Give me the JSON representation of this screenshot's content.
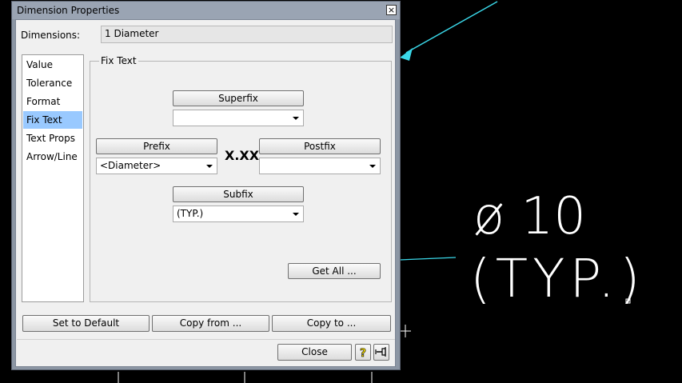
{
  "window": {
    "title": "Dimension Properties",
    "close_glyph": "×"
  },
  "dimensions": {
    "label": "Dimensions:",
    "value": "1 Diameter"
  },
  "sidebar": {
    "items": [
      {
        "label": "Value"
      },
      {
        "label": "Tolerance"
      },
      {
        "label": "Format"
      },
      {
        "label": "Fix Text",
        "selected": true
      },
      {
        "label": "Text Props"
      },
      {
        "label": "Arrow/Line"
      }
    ]
  },
  "fix_text": {
    "group_title": "Fix Text",
    "superfix": {
      "button": "Superfix",
      "value": ""
    },
    "prefix": {
      "button": "Prefix",
      "value": "<Diameter>"
    },
    "value_placeholder": "X.XX",
    "postfix": {
      "button": "Postfix",
      "value": ""
    },
    "subfix": {
      "button": "Subfix",
      "value": "(TYP.)"
    },
    "get_all": "Get All ..."
  },
  "actions": {
    "set_default": "Set to Default",
    "copy_from": "Copy from ...",
    "copy_to": "Copy to ...",
    "close": "Close"
  },
  "icons": {
    "help": "help-icon",
    "pin": "pin-icon"
  },
  "cad": {
    "line1": "ø 10",
    "line2": "(TYP.)",
    "line_color": "#3ad7e8",
    "text_color": "#ffffff"
  }
}
